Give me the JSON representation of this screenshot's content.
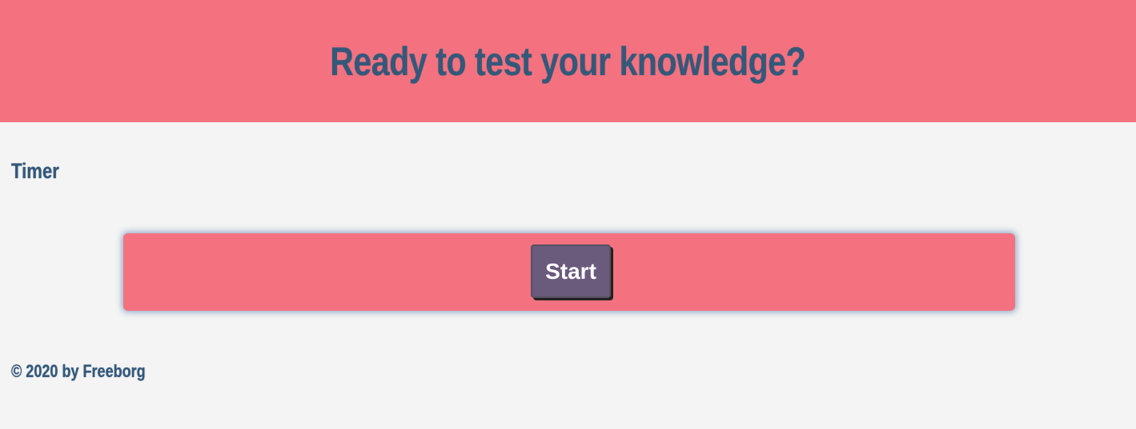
{
  "header": {
    "title": "Ready to test your knowledge?"
  },
  "timer": {
    "label": "Timer"
  },
  "quiz": {
    "start_label": "Start"
  },
  "footer": {
    "text": "© 2020 by Freeborg"
  },
  "colors": {
    "header_bg": "#f4727f",
    "page_bg": "#f4f4f4",
    "text": "#34587a",
    "button_bg": "#6a5a7c",
    "button_text": "#ffffff"
  }
}
